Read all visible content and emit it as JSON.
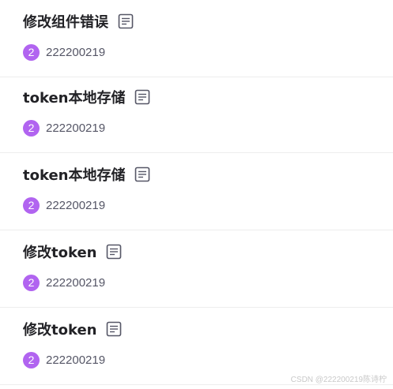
{
  "items": [
    {
      "title": "修改组件错误",
      "badge": "2",
      "author": "222200219"
    },
    {
      "title": "token本地存储",
      "badge": "2",
      "author": "222200219"
    },
    {
      "title": "token本地存储",
      "badge": "2",
      "author": "222200219"
    },
    {
      "title": "修改token",
      "badge": "2",
      "author": "222200219"
    },
    {
      "title": "修改token",
      "badge": "2",
      "author": "222200219"
    }
  ],
  "icons": {
    "doc": "document-icon"
  },
  "colors": {
    "badge": "#b164f0",
    "title": "#222226",
    "author": "#555666"
  },
  "watermark": "CSDN @222200219陈诗柠"
}
